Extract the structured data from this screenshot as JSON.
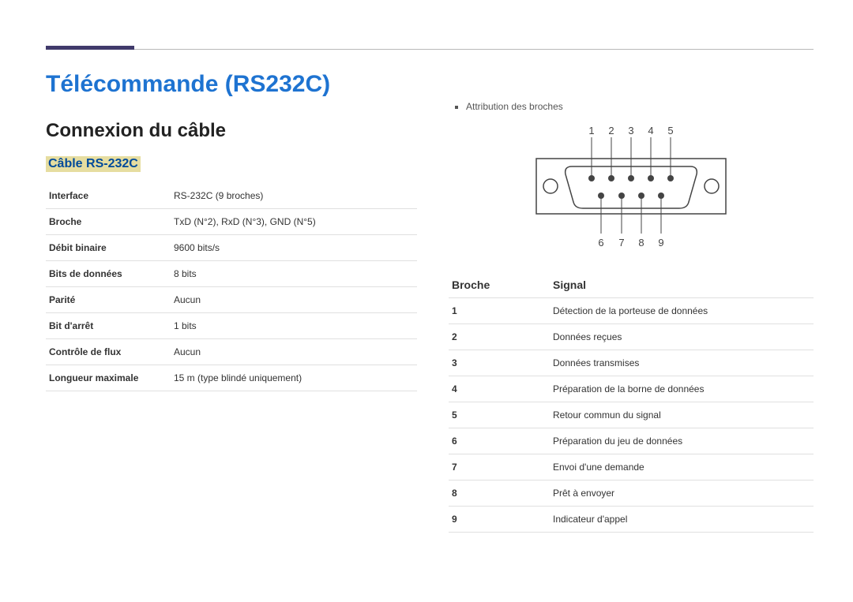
{
  "title": "Télécommande (RS232C)",
  "section": "Connexion du câble",
  "subsection": "Câble RS-232C",
  "spec": [
    {
      "k": "Interface",
      "v": "RS-232C (9 broches)"
    },
    {
      "k": "Broche",
      "v": "TxD (N°2), RxD (N°3), GND (N°5)"
    },
    {
      "k": "Débit binaire",
      "v": "9600 bits/s"
    },
    {
      "k": "Bits de données",
      "v": "8 bits"
    },
    {
      "k": "Parité",
      "v": "Aucun"
    },
    {
      "k": "Bit d'arrêt",
      "v": "1 bits"
    },
    {
      "k": "Contrôle de flux",
      "v": "Aucun"
    },
    {
      "k": "Longueur maximale",
      "v": "15 m (type blindé uniquement)"
    }
  ],
  "pinLabel": "Attribution des broches",
  "pinNumbersTop": [
    "1",
    "2",
    "3",
    "4",
    "5"
  ],
  "pinNumbersBottom": [
    "6",
    "7",
    "8",
    "9"
  ],
  "pinsHeader": {
    "num": "Broche",
    "sig": "Signal"
  },
  "pins": [
    {
      "n": "1",
      "s": "Détection de la porteuse de données"
    },
    {
      "n": "2",
      "s": "Données reçues"
    },
    {
      "n": "3",
      "s": "Données transmises"
    },
    {
      "n": "4",
      "s": "Préparation de la borne de données"
    },
    {
      "n": "5",
      "s": "Retour commun du signal"
    },
    {
      "n": "6",
      "s": "Préparation du jeu de données"
    },
    {
      "n": "7",
      "s": "Envoi d'une demande"
    },
    {
      "n": "8",
      "s": "Prêt à envoyer"
    },
    {
      "n": "9",
      "s": "Indicateur d'appel"
    }
  ]
}
